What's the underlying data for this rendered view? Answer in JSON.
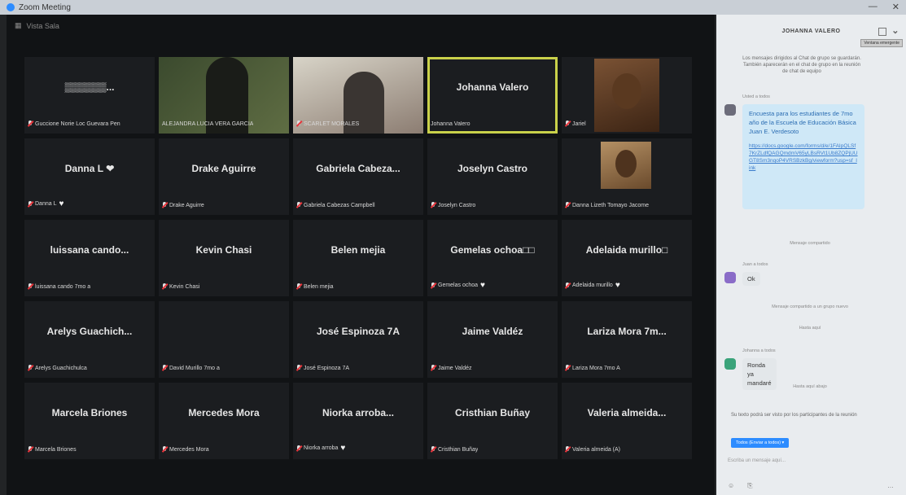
{
  "window": {
    "title": "Zoom Meeting",
    "controls": [
      "—",
      "✕"
    ]
  },
  "meeting": {
    "view_label": "Vista Sala",
    "tiles": [
      {
        "center": "▒▒▒▒▒▒...",
        "label": "Guccione Norie Loc Guevara Pen",
        "video": "none",
        "muted": true
      },
      {
        "center": "",
        "label": "ALEJANDRA LUCIA VERA GARCIA",
        "video": "person",
        "muted": false
      },
      {
        "center": "",
        "label": "SCARLET MORALES",
        "video": "photo",
        "muted": true
      },
      {
        "center": "Johanna Valero",
        "label": "Johanna Valero",
        "video": "none",
        "muted": false,
        "active": true
      },
      {
        "center": "",
        "label": "Jariel",
        "video": "avatar",
        "muted": true
      },
      {
        "center": "Danna L ❤",
        "label": "Danna L",
        "heart": true,
        "video": "none",
        "muted": true
      },
      {
        "center": "Drake Aguirre",
        "label": "Drake Aguirre",
        "video": "none",
        "muted": true
      },
      {
        "center": "Gabriela Cabeza...",
        "label": "Gabriela Cabezas Campbell",
        "video": "none",
        "muted": true
      },
      {
        "center": "Joselyn Castro",
        "label": "Joselyn Castro",
        "video": "none",
        "muted": true
      },
      {
        "center": "",
        "label": "Danna Lizeth Tomayo Jacome",
        "video": "avatar-small",
        "muted": true
      },
      {
        "center": "luissana cando...",
        "label": "luissana cando 7mo a",
        "video": "none",
        "muted": true
      },
      {
        "center": "Kevin Chasi",
        "label": "Kevin Chasi",
        "video": "none",
        "muted": true
      },
      {
        "center": "Belen mejia",
        "label": "Belen mejia",
        "video": "none",
        "muted": true
      },
      {
        "center": "Gemelas ochoa□□",
        "label": "Gemelas ochoa",
        "heart": true,
        "video": "none",
        "muted": true
      },
      {
        "center": "Adelaida murillo□",
        "label": "Adelaida murillo",
        "heart": true,
        "video": "none",
        "muted": true
      },
      {
        "center": "Arelys Guachich...",
        "label": "Arelys Guachichulca",
        "video": "none",
        "muted": true
      },
      {
        "center": "",
        "label": "David Murillo 7mo a",
        "video": "none",
        "muted": true
      },
      {
        "center": "José Espinoza 7A",
        "label": "José Espinoza 7A",
        "video": "none",
        "muted": true
      },
      {
        "center": "Jaime Valdéz",
        "label": "Jaime Valdéz",
        "video": "none",
        "muted": true
      },
      {
        "center": "Lariza Mora 7m...",
        "label": "Lariza Mora 7mo A",
        "video": "none",
        "muted": true
      },
      {
        "center": "Marcela Briones",
        "label": "Marcela Briones",
        "video": "none",
        "muted": true
      },
      {
        "center": "Mercedes Mora",
        "label": "Mercedes Mora",
        "video": "none",
        "muted": true
      },
      {
        "center": "Niorka arroba...",
        "label": "Niorka arroba",
        "heart": true,
        "video": "none",
        "muted": true
      },
      {
        "center": "Cristhian Buñay",
        "label": "Cristhian Buñay",
        "video": "none",
        "muted": true
      },
      {
        "center": "Valeria almeida...",
        "label": "Valeria almeida (A)",
        "video": "none",
        "muted": true
      }
    ]
  },
  "chat": {
    "title": "JOHANNA VALERO",
    "tooltip": "Ventana emergente",
    "system_note": "Los mensajes dirigidos al Chat de grupo se guardarán. También aparecerán en el chat de grupo en la reunión de chat de equipo",
    "msg1_who": "Usted a todos",
    "msg1_text": "Encuesta para los estudiantes de 7mo año de la Escuela de Educación Básica Juan E. Verdesoto",
    "msg1_link": "https://docs.google.com/forms/d/e/1FAIpQLSf7KrZLdfQAGQmdmV65yLBsRVt1Ub8ZQPjUUGT8Sm3nqoP4VRSBzkBg/viewform?usp=sf_link",
    "divider1": "Mensaje compartido",
    "msg2_who": "Juan a todos",
    "msg2_text": "Ok",
    "divider2": "Mensaje compartido a un grupo nuevo",
    "divider3": "Hasta aquí",
    "msg3_who": "Johanna a todos",
    "msg3_text": "Ronda ya mandaré",
    "divider4": "Hasta aquí abajo",
    "input_note": "Su texto podrá ser visto por los participantes de la reunión",
    "to_button": "Todos (Enviar a todos) ▾",
    "placeholder": "Escriba un mensaje aquí...",
    "tools": [
      "☺",
      "⎘",
      "…"
    ]
  }
}
